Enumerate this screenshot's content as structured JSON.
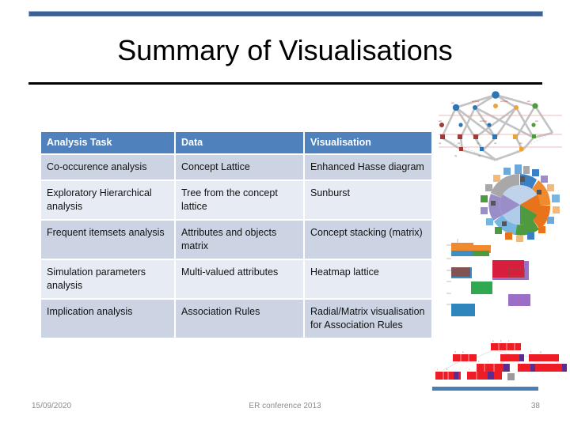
{
  "slide": {
    "title": "Summary of Visualisations",
    "accent_color": "#4F81BD",
    "rule_color": "#000000"
  },
  "table": {
    "headers": [
      "Analysis Task",
      "Data",
      "Visualisation"
    ],
    "rows": [
      {
        "task": "Co-occurence analysis",
        "data": "Concept Lattice",
        "visualisation": "Enhanced Hasse diagram"
      },
      {
        "task": "Exploratory Hierarchical analysis",
        "data": "Tree from the concept lattice",
        "visualisation": "Sunburst"
      },
      {
        "task": "Frequent itemsets analysis",
        "data": "Attributes and objects matrix",
        "visualisation": "Concept stacking (matrix)"
      },
      {
        "task": "Simulation parameters analysis",
        "data": "Multi-valued attributes",
        "visualisation": "Heatmap lattice"
      },
      {
        "task": "Implication analysis",
        "data": "Association Rules",
        "visualisation": "Radial/Matrix visualisation for Association Rules"
      }
    ]
  },
  "visuals": [
    {
      "name": "enhanced-hasse-diagram-thumbnail"
    },
    {
      "name": "sunburst-thumbnail"
    },
    {
      "name": "concept-stacking-matrix-thumbnail"
    },
    {
      "name": "heatmap-lattice-thumbnail"
    }
  ],
  "footer": {
    "date": "15/09/2020",
    "event": "ER conference 2013",
    "page": "38"
  }
}
